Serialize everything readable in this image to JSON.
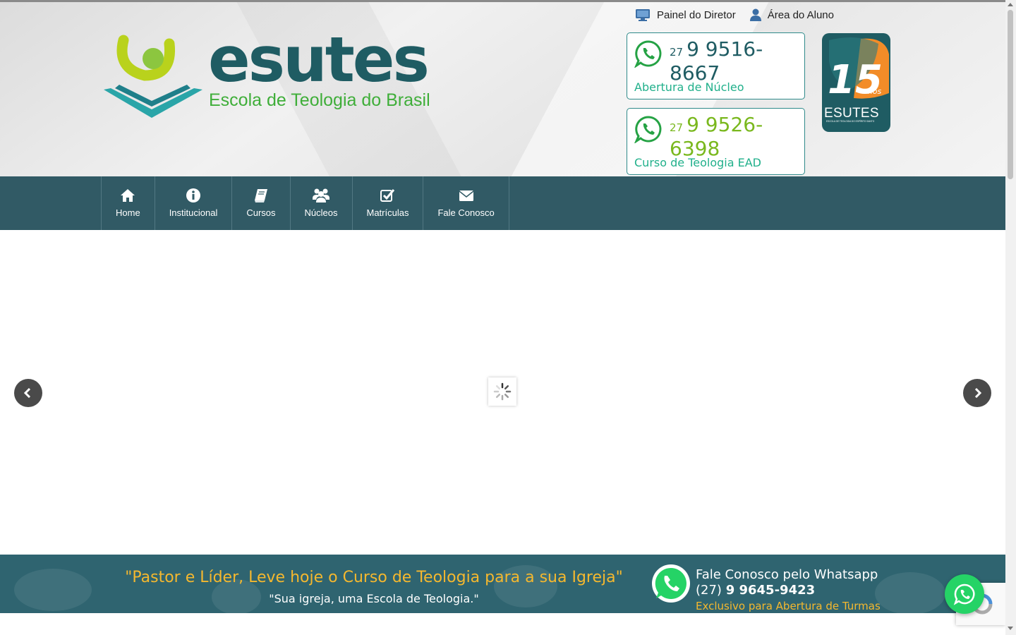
{
  "top_links": [
    {
      "label": "Painel do Diretor",
      "icon": "desktop-icon"
    },
    {
      "label": "Área do Aluno",
      "icon": "user-icon"
    }
  ],
  "logo": {
    "name": "esutes",
    "tagline": "Escola de Teologia do Brasil"
  },
  "phones": [
    {
      "ddd": "27",
      "number": "9 9516-8667",
      "label": "Abertura de Núcleo",
      "color": "#1f5c63"
    },
    {
      "ddd": "27",
      "number": "9 9526-6398",
      "label": "Curso de Teologia EAD",
      "color": "#7ab81e"
    }
  ],
  "badge": {
    "number": "15",
    "suffix": "anos",
    "name": "ESUTES",
    "subtitle": "ESCOLA DE TEOLOGIA DO ESPÍRITO SANTO"
  },
  "nav": [
    {
      "label": "Home",
      "icon": "home-icon"
    },
    {
      "label": "Institucional",
      "icon": "info-icon"
    },
    {
      "label": "Cursos",
      "icon": "book-icon"
    },
    {
      "label": "Núcleos",
      "icon": "users-icon"
    },
    {
      "label": "Matrículas",
      "icon": "check-square-icon"
    },
    {
      "label": "Fale Conosco",
      "icon": "envelope-icon"
    }
  ],
  "footer_band": {
    "quote": "\"Pastor e Líder, Leve hoje o Curso de Teologia para a sua Igreja\"",
    "subquote": "\"Sua igreja, uma Escola de Teologia.\"",
    "whatsapp_title": "Fale Conosco pelo Whatsapp",
    "whatsapp_ddd": "(27)",
    "whatsapp_number": "9 9645-9423",
    "whatsapp_note": "Exclusivo para Abertura de Turmas"
  },
  "colors": {
    "primary": "#315a65",
    "accent_green": "#7ab81e",
    "teal_text": "#21b08b",
    "quote_yellow": "#f5b82e",
    "whatsapp_green": "#25d366"
  }
}
